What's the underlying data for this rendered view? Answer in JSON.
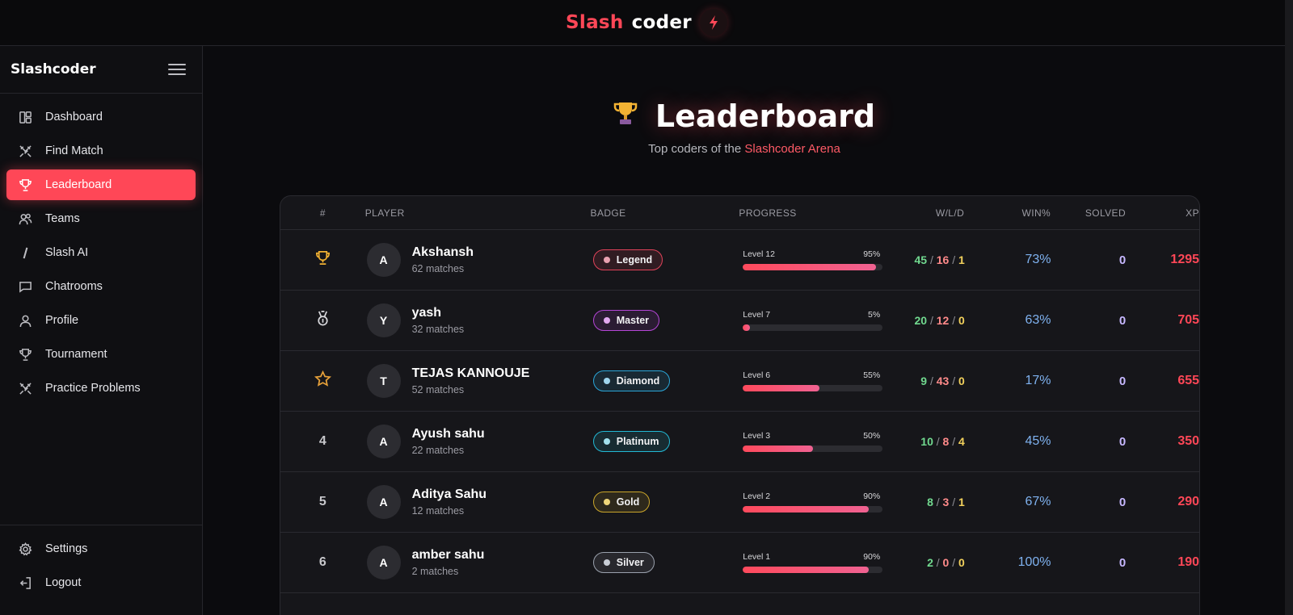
{
  "brand": {
    "word1": "Slash",
    "word2": "coder",
    "mark": "⚡"
  },
  "sidebar": {
    "title": "Slashcoder",
    "items": [
      {
        "label": "Dashboard",
        "icon": "dashboard-icon"
      },
      {
        "label": "Find Match",
        "icon": "swords-icon"
      },
      {
        "label": "Leaderboard",
        "icon": "trophy-icon",
        "active": true
      },
      {
        "label": "Teams",
        "icon": "users-icon"
      },
      {
        "label": "Slash AI",
        "icon": "slash-icon"
      },
      {
        "label": "Chatrooms",
        "icon": "chat-icon"
      },
      {
        "label": "Profile",
        "icon": "user-icon"
      },
      {
        "label": "Tournament",
        "icon": "trophy-icon"
      },
      {
        "label": "Practice Problems",
        "icon": "swords-icon"
      }
    ],
    "footer": [
      {
        "label": "Settings",
        "icon": "gear-icon"
      },
      {
        "label": "Logout",
        "icon": "logout-icon"
      }
    ]
  },
  "hero": {
    "title": "Leaderboard",
    "subtitle_pre": "Top coders of the ",
    "subtitle_accent": "Slashcoder Arena"
  },
  "table": {
    "headers": {
      "rank": "#",
      "player": "PLAYER",
      "badge": "BADGE",
      "progress": "PROGRESS",
      "wld": "W/L/D",
      "win": "WIN%",
      "solved": "SOLVED",
      "xp": "XP"
    },
    "rows": [
      {
        "rank": "",
        "rank_icon": "trophy-icon",
        "initial": "A",
        "name": "Akshansh",
        "matches": "62 matches",
        "badge": "Legend",
        "badge_color": "#e0435a",
        "dot_color": "#e8a1b0",
        "level": "Level 12",
        "pct": "95%",
        "progress": 0.95,
        "w": "45",
        "l": "16",
        "d": "1",
        "win": "73%",
        "solved": "0",
        "xp": "1295"
      },
      {
        "rank": "",
        "rank_icon": "medal-icon",
        "initial": "Y",
        "name": "yash",
        "matches": "32 matches",
        "badge": "Master",
        "badge_color": "#b445d6",
        "dot_color": "#e2a8f0",
        "level": "Level 7",
        "pct": "5%",
        "progress": 0.05,
        "w": "20",
        "l": "12",
        "d": "0",
        "win": "63%",
        "solved": "0",
        "xp": "705"
      },
      {
        "rank": "",
        "rank_icon": "star-icon",
        "initial": "T",
        "name": "TEJAS KANNOUJE",
        "matches": "52 matches",
        "badge": "Diamond",
        "badge_color": "#2aa6d8",
        "dot_color": "#9fd6ee",
        "level": "Level 6",
        "pct": "55%",
        "progress": 0.55,
        "w": "9",
        "l": "43",
        "d": "0",
        "win": "17%",
        "solved": "0",
        "xp": "655"
      },
      {
        "rank": "4",
        "rank_icon": "",
        "initial": "A",
        "name": "Ayush sahu",
        "matches": "22 matches",
        "badge": "Platinum",
        "badge_color": "#22b8d4",
        "dot_color": "#a3e2ee",
        "level": "Level 3",
        "pct": "50%",
        "progress": 0.5,
        "w": "10",
        "l": "8",
        "d": "4",
        "win": "45%",
        "solved": "0",
        "xp": "350"
      },
      {
        "rank": "5",
        "rank_icon": "",
        "initial": "A",
        "name": "Aditya Sahu",
        "matches": "12 matches",
        "badge": "Gold",
        "badge_color": "#c9a52a",
        "dot_color": "#f0d77a",
        "level": "Level 2",
        "pct": "90%",
        "progress": 0.9,
        "w": "8",
        "l": "3",
        "d": "1",
        "win": "67%",
        "solved": "0",
        "xp": "290"
      },
      {
        "rank": "6",
        "rank_icon": "",
        "initial": "A",
        "name": "amber sahu",
        "matches": "2 matches",
        "badge": "Silver",
        "badge_color": "#9aa1ad",
        "dot_color": "#c9ced6",
        "level": "Level 1",
        "pct": "90%",
        "progress": 0.9,
        "w": "2",
        "l": "0",
        "d": "0",
        "win": "100%",
        "solved": "0",
        "xp": "190"
      }
    ]
  },
  "colors": {
    "accent": "#ff4757",
    "win_pct": "#7fb2f0",
    "solved": "#c7b8ff",
    "xp": "#ff4757"
  }
}
